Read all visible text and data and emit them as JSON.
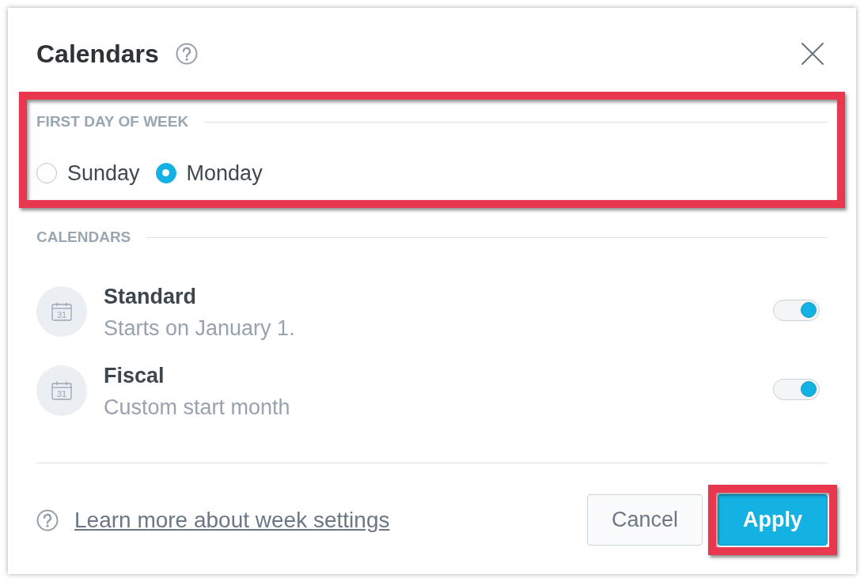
{
  "dialog": {
    "title": "Calendars"
  },
  "first_day_of_week": {
    "heading": "FIRST DAY OF WEEK",
    "highlighted": true,
    "options": [
      {
        "label": "Sunday",
        "selected": false
      },
      {
        "label": "Monday",
        "selected": true
      }
    ]
  },
  "calendars": {
    "heading": "CALENDARS",
    "items": [
      {
        "name": "Standard",
        "description": "Starts on January 1.",
        "icon_text": "31",
        "on": true
      },
      {
        "name": "Fiscal",
        "description": "Custom start month",
        "icon_text": "31",
        "on": true
      }
    ]
  },
  "footer": {
    "help_link": "Learn more about week settings",
    "buttons": [
      {
        "label": "Cancel",
        "kind": "secondary",
        "highlighted": false
      },
      {
        "label": "Apply",
        "kind": "primary",
        "highlighted": true
      }
    ]
  }
}
